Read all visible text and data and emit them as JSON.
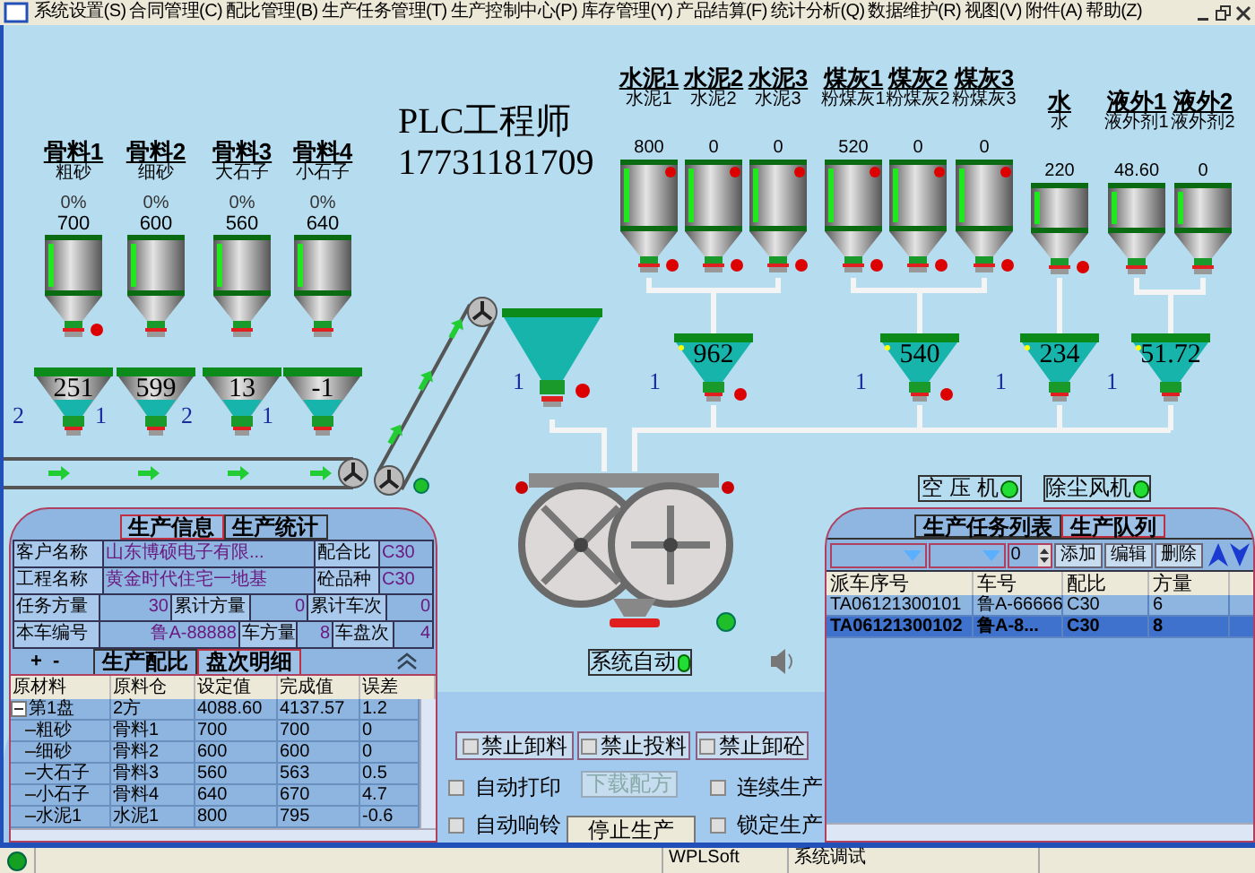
{
  "menu": [
    "系统设置(S)",
    "合同管理(C)",
    "配比管理(B)",
    "生产任务管理(T)",
    "生产控制中心(P)",
    "库存管理(Y)",
    "产品结算(F)",
    "统计分析(Q)",
    "数据维护(R)",
    "视图(V)",
    "附件(A)",
    "帮助(Z)"
  ],
  "overlay_text": [
    "PLC工程师",
    "17731181709"
  ],
  "aggregates": [
    {
      "title": "骨料1",
      "material": "粗砂",
      "percent": "0%",
      "weight": "700",
      "hopper_value": "251",
      "hopper_number": "2"
    },
    {
      "title": "骨料2",
      "material": "细砂",
      "percent": "0%",
      "weight": "600",
      "hopper_value": "599",
      "hopper_number": "1"
    },
    {
      "title": "骨料3",
      "material": "大石子",
      "percent": "0%",
      "weight": "560",
      "hopper_value": "13",
      "hopper_number": "2"
    },
    {
      "title": "骨料4",
      "material": "小石子",
      "percent": "0%",
      "weight": "640",
      "hopper_value": "-1",
      "hopper_number": "1"
    }
  ],
  "cement_silos": [
    {
      "title": "水泥1",
      "material": "水泥1",
      "value": "800"
    },
    {
      "title": "水泥2",
      "material": "水泥2",
      "value": "0"
    },
    {
      "title": "水泥3",
      "material": "水泥3",
      "value": "0"
    }
  ],
  "flyash_silos": [
    {
      "title": "煤灰1",
      "material": "粉煤灰1",
      "value": "520"
    },
    {
      "title": "煤灰2",
      "material": "粉煤灰2",
      "value": "0"
    },
    {
      "title": "煤灰3",
      "material": "粉煤灰3",
      "value": "0"
    }
  ],
  "water_silos": [
    {
      "title": "水",
      "material": "水",
      "value": "220"
    }
  ],
  "admixture_silos": [
    {
      "title": "液外1",
      "material": "液外剂1",
      "value": "48.60"
    },
    {
      "title": "液外2",
      "material": "液外剂2",
      "value": "0"
    }
  ],
  "weigh_hoppers": [
    {
      "value": "962",
      "number": "1"
    },
    {
      "value": "540",
      "number": "1"
    },
    {
      "value": "234",
      "number": "1"
    },
    {
      "value": "51.72",
      "number": "1"
    }
  ],
  "mixer_hopper": {
    "number": "1"
  },
  "status_buttons": [
    {
      "label": "空 压 机",
      "on": true
    },
    {
      "label": "除尘风机",
      "on": true
    },
    {
      "label": "系统自动",
      "on": true
    }
  ],
  "production_panel": {
    "tabs": [
      {
        "label": "生产信息",
        "selected": true
      },
      {
        "label": "生产统计",
        "selected": false
      }
    ],
    "info_rows": [
      [
        {
          "label": "客户名称",
          "value": "山东博硕电子有限..."
        },
        {
          "label": "配合比",
          "value": "C30"
        }
      ],
      [
        {
          "label": "工程名称",
          "value": "黄金时代住宅一地基"
        },
        {
          "label": "砼品种",
          "value": "C30"
        }
      ],
      [
        {
          "label": "任务方量",
          "value": "30"
        },
        {
          "label": "累计方量",
          "value": "0"
        },
        {
          "label": "累计车次",
          "value": "0"
        }
      ],
      [
        {
          "label": "本车编号",
          "value": "鲁A-88888"
        },
        {
          "label": "车方量",
          "value": "8"
        },
        {
          "label": "车盘次",
          "value": "4"
        }
      ]
    ],
    "expand_buttons": [
      "+",
      "-"
    ],
    "sub_tabs": [
      {
        "label": "生产配比",
        "selected": false
      },
      {
        "label": "盘次明细",
        "selected": true
      }
    ],
    "table": {
      "columns": [
        "原材料",
        "原料仓",
        "设定值",
        "完成值",
        "误差"
      ],
      "rows": [
        {
          "cells": [
            "第1盘",
            "2方",
            "4088.60",
            "4137.57",
            "1.2"
          ],
          "expanded": true,
          "children": [
            {
              "cells": [
                "粗砂",
                "骨料1",
                "700",
                "700",
                "0"
              ]
            },
            {
              "cells": [
                "细砂",
                "骨料2",
                "600",
                "600",
                "0"
              ]
            },
            {
              "cells": [
                "大石子",
                "骨料3",
                "560",
                "563",
                "0.5"
              ]
            },
            {
              "cells": [
                "小石子",
                "骨料4",
                "640",
                "670",
                "4.7"
              ]
            },
            {
              "cells": [
                "水泥1",
                "水泥1",
                "800",
                "795",
                "-0.6"
              ]
            }
          ]
        }
      ]
    }
  },
  "controls": {
    "toggle_buttons": [
      {
        "label": "禁止卸料",
        "checked": false
      },
      {
        "label": "禁止投料",
        "checked": false
      },
      {
        "label": "禁止卸砼",
        "checked": false
      }
    ],
    "checkboxes": [
      {
        "label": "自动打印",
        "checked": false
      },
      {
        "label": "自动响铃",
        "checked": false
      },
      {
        "label": "连续生产",
        "checked": false
      },
      {
        "label": "锁定生产",
        "checked": false
      }
    ],
    "buttons": [
      {
        "label": "下载配方",
        "disabled": true
      },
      {
        "label": "停止生产",
        "disabled": false
      }
    ]
  },
  "task_panel": {
    "tabs": [
      {
        "label": "生产任务列表",
        "selected": false
      },
      {
        "label": "生产队列",
        "selected": true
      }
    ],
    "toolbar": {
      "count": "0",
      "buttons": [
        "添加",
        "编辑",
        "删除"
      ]
    },
    "table": {
      "columns": [
        "派车序号",
        "车号",
        "配比",
        "方量"
      ],
      "rows": [
        {
          "cells": [
            "TA06121300101",
            "鲁A-66666",
            "C30",
            "6"
          ],
          "selected": false
        },
        {
          "cells": [
            "TA06121300102",
            "鲁A-8...",
            "C30",
            "8"
          ],
          "selected": true
        }
      ]
    }
  },
  "status_bar": [
    "WPLSoft",
    "系统调试"
  ]
}
